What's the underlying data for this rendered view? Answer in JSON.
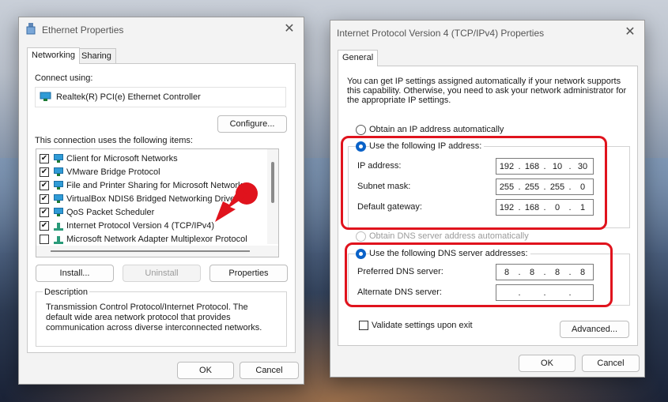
{
  "colors": {
    "accent": "#0a62c8",
    "highlight": "#e0131d"
  },
  "ethernet": {
    "title": "Ethernet Properties",
    "tabs": [
      "Networking",
      "Sharing"
    ],
    "connect_using_label": "Connect using:",
    "adapter": "Realtek(R) PCI(e) Ethernet Controller",
    "configure_btn": "Configure...",
    "items_label": "This connection uses the following items:",
    "items": [
      {
        "label": "Client for Microsoft Networks",
        "checked": true,
        "icon": "network-client-icon"
      },
      {
        "label": "VMware Bridge Protocol",
        "checked": true,
        "icon": "network-client-icon"
      },
      {
        "label": "File and Printer Sharing for Microsoft Networks",
        "checked": true,
        "icon": "network-client-icon"
      },
      {
        "label": "VirtualBox NDIS6 Bridged Networking Driver",
        "checked": true,
        "icon": "network-client-icon"
      },
      {
        "label": "QoS Packet Scheduler",
        "checked": true,
        "icon": "network-client-icon"
      },
      {
        "label": "Internet Protocol Version 4 (TCP/IPv4)",
        "checked": true,
        "icon": "protocol-icon"
      },
      {
        "label": "Microsoft Network Adapter Multiplexor Protocol",
        "checked": false,
        "icon": "protocol-icon"
      }
    ],
    "install_btn": "Install...",
    "uninstall_btn": "Uninstall",
    "properties_btn": "Properties",
    "description_label": "Description",
    "description_text": "Transmission Control Protocol/Internet Protocol. The default wide area network protocol that provides communication across diverse interconnected networks.",
    "ok_btn": "OK",
    "cancel_btn": "Cancel"
  },
  "ipv4": {
    "title": "Internet Protocol Version 4 (TCP/IPv4) Properties",
    "tab": "General",
    "intro": "You can get IP settings assigned automatically if your network supports this capability. Otherwise, you need to ask your network administrator for the appropriate IP settings.",
    "obtain_ip_auto": "Obtain an IP address automatically",
    "use_ip": "Use the following IP address:",
    "ip_label": "IP address:",
    "ip_value": [
      "192",
      "168",
      "10",
      "30"
    ],
    "subnet_label": "Subnet mask:",
    "subnet_value": [
      "255",
      "255",
      "255",
      "0"
    ],
    "gateway_label": "Default gateway:",
    "gateway_value": [
      "192",
      "168",
      "0",
      "1"
    ],
    "obtain_dns_auto": "Obtain DNS server address automatically",
    "use_dns": "Use the following DNS server addresses:",
    "preferred_dns_label": "Preferred DNS server:",
    "preferred_dns_value": [
      "8",
      "8",
      "8",
      "8"
    ],
    "alternate_dns_label": "Alternate DNS server:",
    "alternate_dns_value": [
      "",
      "",
      "",
      ""
    ],
    "validate_label": "Validate settings upon exit",
    "advanced_btn": "Advanced...",
    "ok_btn": "OK",
    "cancel_btn": "Cancel"
  }
}
